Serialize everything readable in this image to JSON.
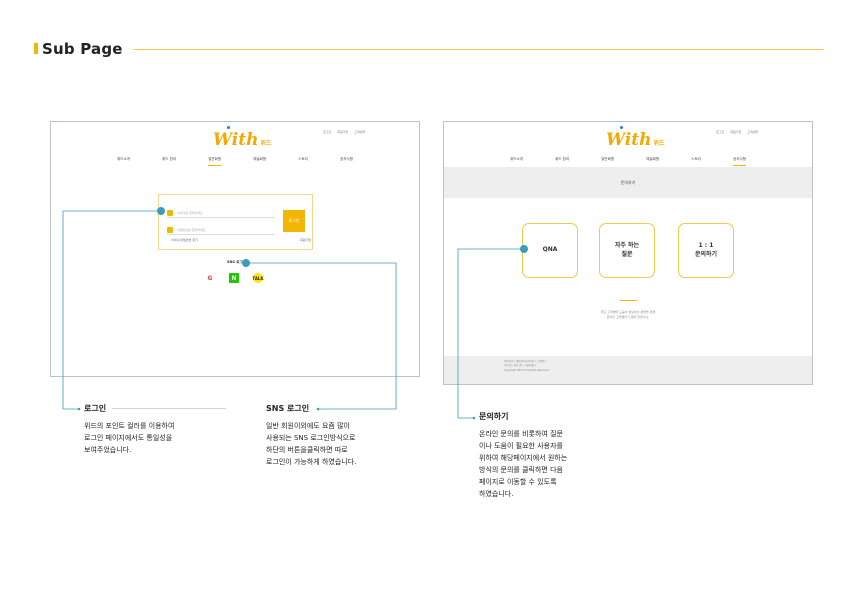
{
  "header": {
    "title": "Sub Page",
    "accent_color": "#f2b705"
  },
  "login_mock": {
    "logo": {
      "text": "With",
      "sub": "위드"
    },
    "util_links": [
      "로그인",
      "회원가입",
      "고객센터"
    ],
    "nav": [
      "위드소개",
      "위드 참여",
      "일반회원",
      "예술회원",
      "스토리",
      "공지사항"
    ],
    "active_nav": "일반회원",
    "id_placeholder": "아이디를 입력하세요",
    "pw_placeholder": "비밀번호를 입력하세요",
    "login_button": "로그인",
    "find_link": "아이디/비밀번호 찾기",
    "signup_link": "회원가입",
    "sns_title": "SNS 로그인",
    "sns_icons": [
      "google-icon",
      "naver-icon",
      "kakao-icon"
    ],
    "sns_glyphs": {
      "google": "G",
      "naver": "N",
      "kakao": "TALK"
    }
  },
  "cs_mock": {
    "logo": {
      "text": "With",
      "sub": "위드"
    },
    "util_links": [
      "로그인",
      "회원가입",
      "고객센터"
    ],
    "nav": [
      "위드소개",
      "위드 참여",
      "일반회원",
      "예술회원",
      "스토리",
      "공지사항"
    ],
    "active_nav": "공지사항",
    "band_title": "문의하기",
    "cards": {
      "qna": "QNA",
      "faq": "자주 하는\n질문",
      "one": "1 : 1\n문의하기"
    },
    "cs_text": "위드 고객센터 도움이 필요하신 분들을 위해\n온라인 고객센터가 열려 있습니다.",
    "footer": "이용약관 | 개인정보처리방침 | 고객센터\n(주)위드 대표 위드 서울특별시\nCopyright WITH All Rights Reserved."
  },
  "annotations": {
    "login": {
      "title": "로그인",
      "body": "위드의 포인트 컬러를 이용하여\n로그인 페이지에서도 통일성을\n보여주었습니다."
    },
    "sns": {
      "title": "SNS 로그인",
      "body": "일반 회원이외에도 요즘 많이\n사용되는 SNS 로그인방식으로\n하단의 버튼을클릭하면 따로\n로그인이 가능하게 하였습니다."
    },
    "qna": {
      "title": "문의하기",
      "body": "온라인 문의를 비롯하여 질문\n이나 도움이 필요한 사용자를\n위하여 해당페이지에서 원하는\n방식의 문의를 클릭하면 다음\n페이지로 이동할 수 있도록\n하였습니다."
    }
  },
  "colors": {
    "point": "#f2b705",
    "connector": "#3a9fb5",
    "frame": "#b9c3cc"
  }
}
